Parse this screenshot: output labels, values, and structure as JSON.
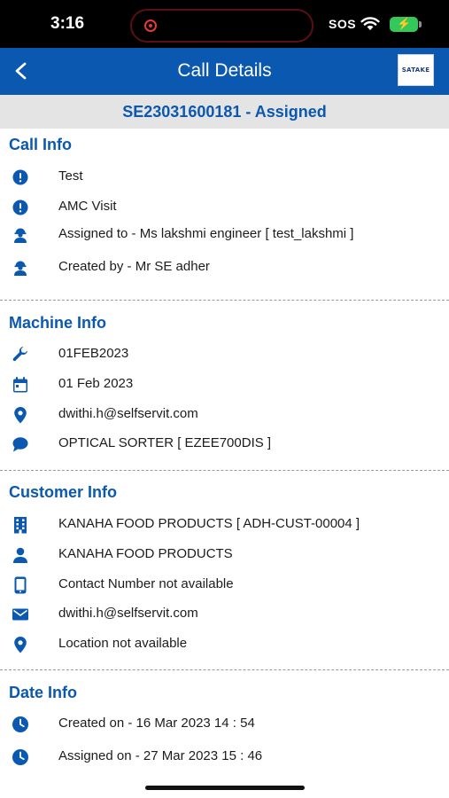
{
  "status_bar": {
    "time": "3:16",
    "sos": "SOS"
  },
  "header": {
    "title": "Call Details",
    "logo_text": "SATAKE"
  },
  "call_banner": "SE23031600181 - Assigned",
  "call_info": {
    "title": "Call Info",
    "items": [
      {
        "icon": "alert-icon",
        "text": "Test"
      },
      {
        "icon": "alert-icon",
        "text": "AMC Visit"
      },
      {
        "icon": "engineer-icon",
        "text": "Assigned to - Ms lakshmi engineer [ test_lakshmi ]"
      },
      {
        "icon": "engineer-icon",
        "text": "Created by - Mr SE adher"
      }
    ]
  },
  "machine_info": {
    "title": "Machine Info",
    "items": [
      {
        "icon": "wrench-icon",
        "text": "01FEB2023"
      },
      {
        "icon": "calendar-icon",
        "text": "01 Feb 2023"
      },
      {
        "icon": "location-pin-icon",
        "text": "dwithi.h@selfservit.com"
      },
      {
        "icon": "chat-bubble-icon",
        "text": "OPTICAL SORTER [ EZEE700DIS ]"
      }
    ]
  },
  "customer_info": {
    "title": "Customer Info",
    "items": [
      {
        "icon": "building-icon",
        "text": "KANAHA FOOD PRODUCTS [ ADH-CUST-00004 ]"
      },
      {
        "icon": "person-icon",
        "text": "KANAHA FOOD PRODUCTS"
      },
      {
        "icon": "phone-icon",
        "text": "Contact Number not available"
      },
      {
        "icon": "mail-icon",
        "text": "dwithi.h@selfservit.com"
      },
      {
        "icon": "location-pin-icon",
        "text": "Location not available"
      }
    ]
  },
  "date_info": {
    "title": "Date Info",
    "items": [
      {
        "icon": "clock-icon",
        "text": "Created on - 16 Mar 2023 14 : 54"
      },
      {
        "icon": "clock-icon",
        "text": "Assigned on - 27 Mar 2023 15 : 46"
      }
    ]
  },
  "colors": {
    "primary": "#0b58b0",
    "banner_bg": "#e4e4e4",
    "icon": "#0b58b0"
  }
}
